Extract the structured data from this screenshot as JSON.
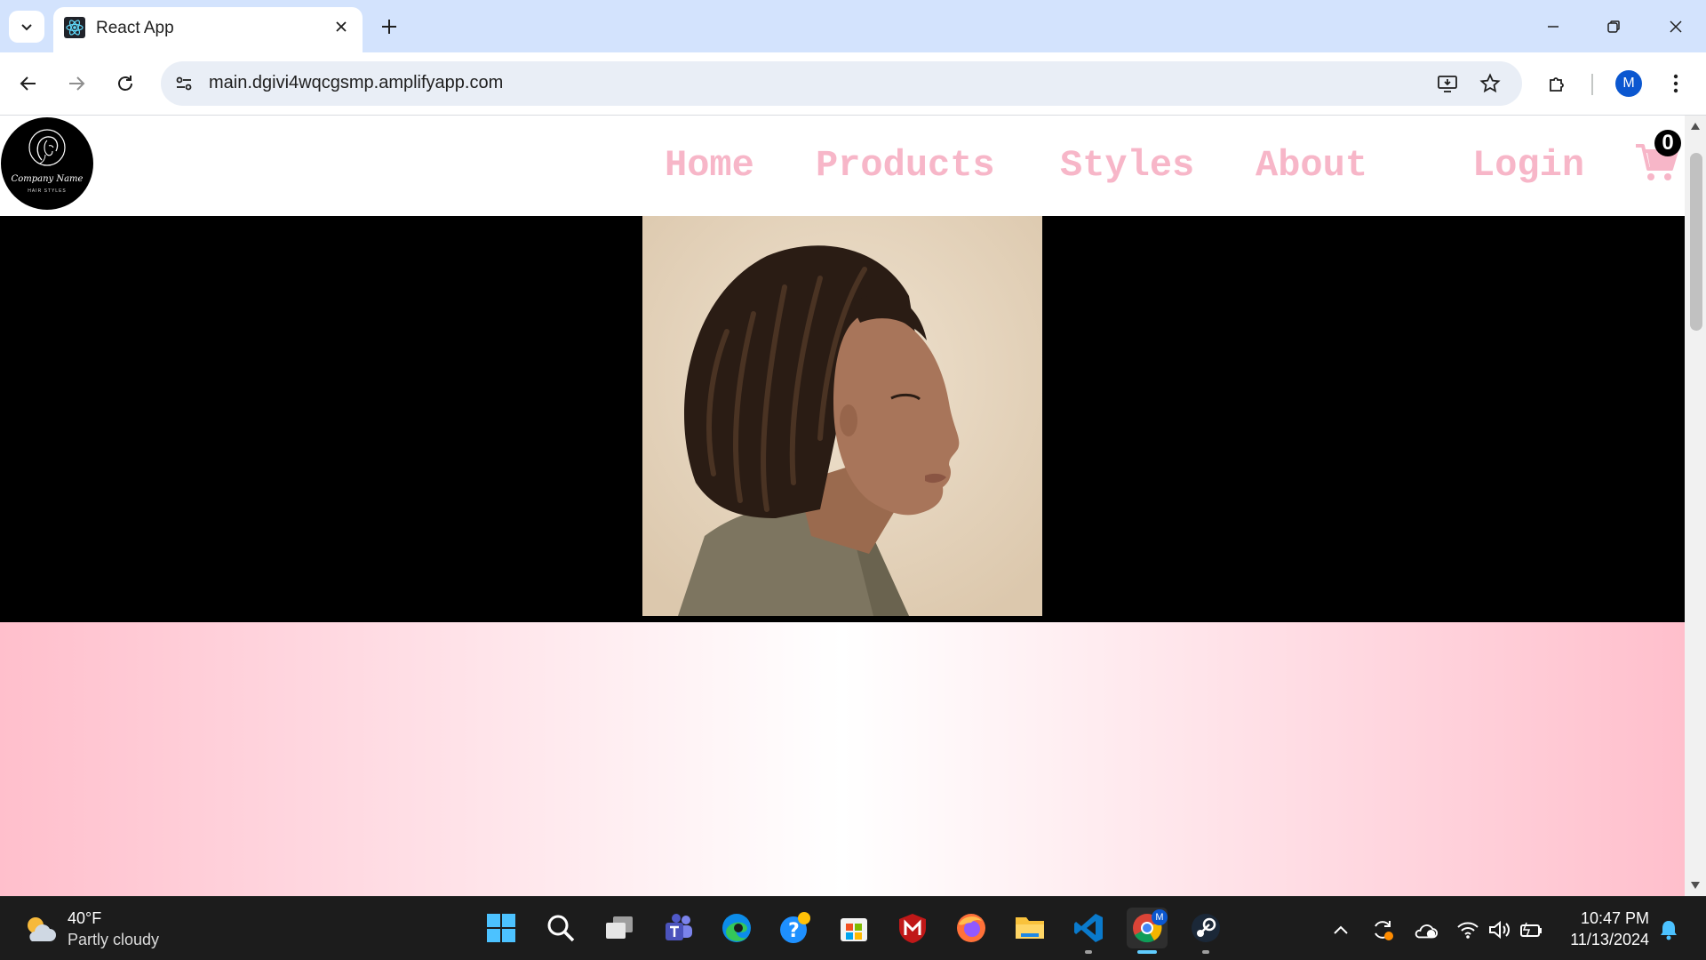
{
  "browser": {
    "tab_title": "React App",
    "url": "main.dgivi4wqcgsmp.amplifyapp.com",
    "profile_initial": "M"
  },
  "site": {
    "logo": {
      "name": "Company Name",
      "tagline": "HAIR STYLES"
    },
    "nav": {
      "home": "Home",
      "products": "Products",
      "styles": "Styles",
      "about": "About",
      "login": "Login"
    },
    "cart_count": "0",
    "colors": {
      "nav_pink": "#f7b6c8",
      "gradient_pink": "#ffbfcc"
    }
  },
  "taskbar": {
    "weather": {
      "temp": "40°F",
      "desc": "Partly cloudy"
    },
    "clock": {
      "time": "10:47 PM",
      "date": "11/13/2024"
    },
    "chrome_profile_badge": "M"
  }
}
